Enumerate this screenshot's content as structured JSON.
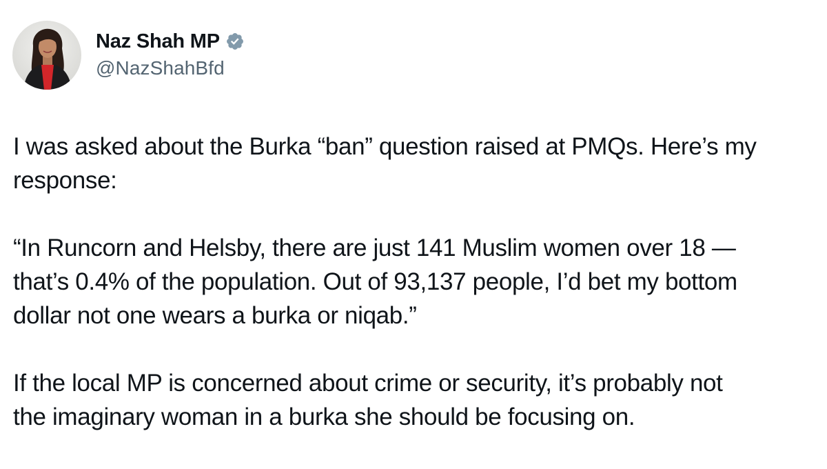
{
  "author": {
    "display_name": "Naz Shah MP",
    "handle": "@NazShahBfd",
    "avatar_icon": "profile-photo",
    "verified_icon": "verified-badge-icon",
    "verified_color": "#829aab"
  },
  "tweet": {
    "paragraphs": [
      {
        "lines": [
          "I was asked about the Burka “ban” question raised at PMQs. Here’s my",
          "response:"
        ]
      },
      {
        "lines": [
          "“In Runcorn and Helsby, there are just 141 Muslim women over 18 —",
          "that’s 0.4% of the population. Out of 93,137 people, I’d bet my bottom",
          "dollar not one wears a burka or niqab.”"
        ]
      },
      {
        "lines": [
          "If the local MP is concerned about crime or security, it’s probably not",
          "the imaginary woman in a burka she should be focusing on."
        ]
      }
    ]
  },
  "colors": {
    "text": "#0f1419",
    "secondary_text": "#536471",
    "background": "#ffffff"
  }
}
